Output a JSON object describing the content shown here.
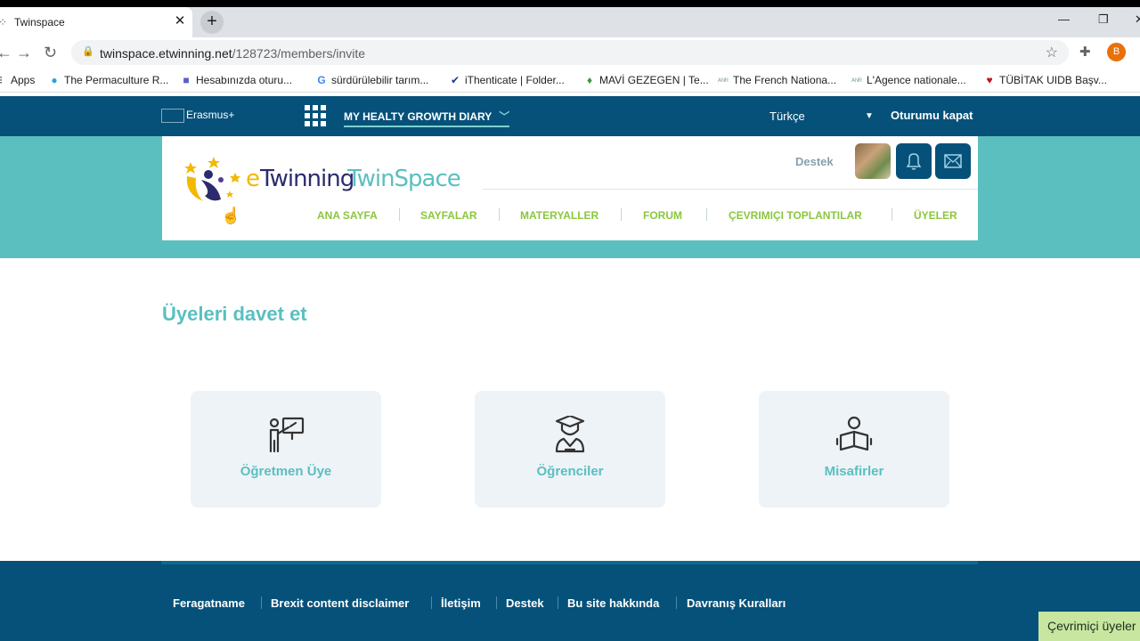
{
  "browser": {
    "tab_title": "Twinspace",
    "tab_close": "✕",
    "new_tab": "+",
    "url_domain": "twinspace.etwinning.net",
    "url_path": "/128723/members/invite",
    "profile_initial": "B",
    "bookmarks": [
      {
        "label": "Apps",
        "icon": "apps-icon"
      },
      {
        "label": "The Permaculture R...",
        "icon": "drop-icon"
      },
      {
        "label": "Hesabınızda oturu...",
        "icon": "teams-icon"
      },
      {
        "label": "sürdürülebilir tarım...",
        "icon": "google-icon"
      },
      {
        "label": "iThenticate | Folder...",
        "icon": "check-icon"
      },
      {
        "label": "MAVİ GEZEGEN | Te...",
        "icon": "leaf-icon"
      },
      {
        "label": "The French Nationa...",
        "icon": "anr-icon"
      },
      {
        "label": "L'Agence nationale...",
        "icon": "anr-icon"
      },
      {
        "label": "TÜBİTAK UIDB Başv...",
        "icon": "tubitak-icon"
      }
    ]
  },
  "site": {
    "erasmus_label": "Erasmus+",
    "project_title": "MY HEALTY GROWTH DIARY",
    "language": "Türkçe",
    "logout": "Oturumu kapat",
    "logo_e": "e",
    "logo_twinning": "Twinning",
    "logo_twinspace": "TwinSpace",
    "support": "Destek",
    "nav": [
      "ANA SAYFA",
      "SAYFALAR",
      "MATERYALLER",
      "FORUM",
      "ÇEVRIMIÇI TOPLANTILAR",
      "ÜYELER"
    ]
  },
  "main": {
    "title": "Üyeleri davet et",
    "cards": [
      {
        "label": "Öğretmen Üye",
        "icon": "teacher-icon"
      },
      {
        "label": "Öğrenciler",
        "icon": "student-icon"
      },
      {
        "label": "Misafirler",
        "icon": "guest-reader-icon"
      }
    ]
  },
  "footer": {
    "links": [
      "Feragatname",
      "Brexit content disclaimer",
      "İletişim",
      "Destek",
      "Bu site hakkında",
      "Davranış Kuralları"
    ],
    "online_users": "Çevrimiçi üyeler"
  },
  "colors": {
    "brand_navy": "#065179",
    "brand_teal": "#5bbfc0",
    "nav_green": "#8bc63e"
  }
}
